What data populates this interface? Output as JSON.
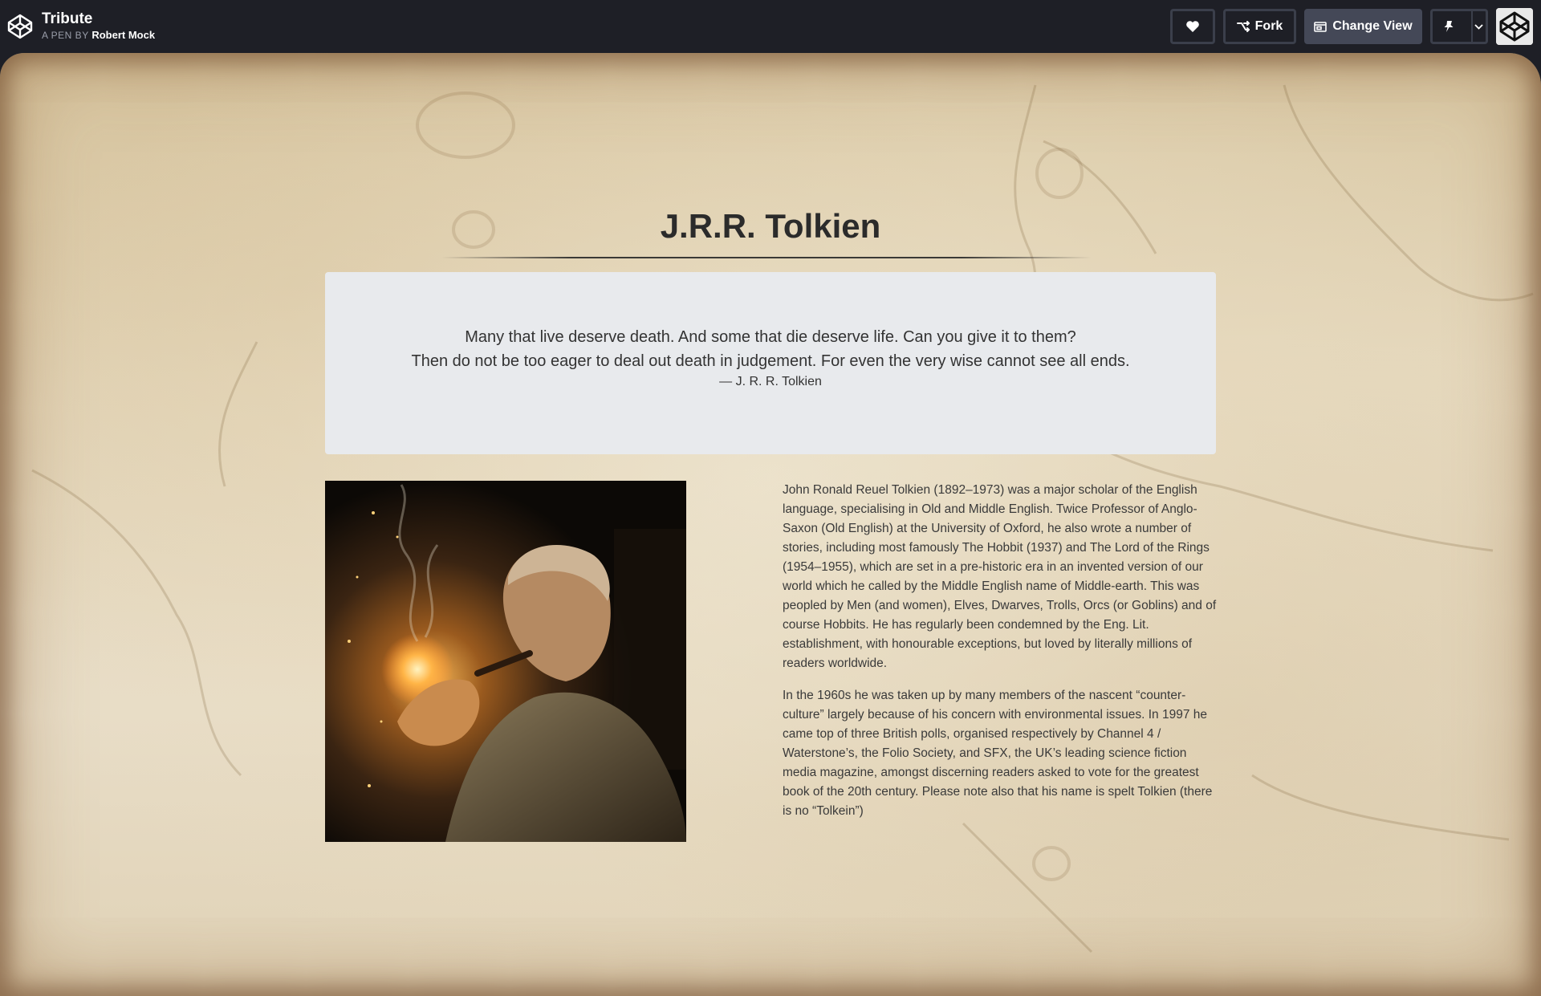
{
  "header": {
    "logo_icon": "codepen-logo-icon",
    "pen_title": "Tribute",
    "pen_by_label": "A PEN BY",
    "author": "Robert Mock",
    "buttons": {
      "heart_icon": "heart-icon",
      "fork_label": "Fork",
      "fork_icon": "fork-icon",
      "change_view_label": "Change View",
      "change_view_icon": "window-icon",
      "pin_icon": "pin-icon",
      "chevron_icon": "chevron-down-icon"
    },
    "avatar_icon": "codepen-avatar"
  },
  "main": {
    "title": "J.R.R. Tolkien",
    "quote": {
      "line1": "Many that live deserve death. And some that die deserve life. Can you give it to them?",
      "line2": "Then do not be too eager to deal out death in judgement. For even the very wise cannot see all ends.",
      "author": "— J. R. R. Tolkien"
    },
    "image": {
      "subject": "tolkien-portrait-lighting-pipe"
    },
    "bio": {
      "paragraph1": "John Ronald Reuel Tolkien (1892–1973) was a major scholar of the English language, specialising in Old and Middle English. Twice Professor of Anglo-Saxon (Old English) at the University of Oxford, he also wrote a number of stories, including most famously The Hobbit (1937) and The Lord of the Rings (1954–1955), which are set in a pre-historic era in an invented version of our world which he called by the Middle English name of Middle-earth. This was peopled by Men (and women), Elves, Dwarves, Trolls, Orcs (or Goblins) and of course Hobbits. He has regularly been condemned by the Eng. Lit. establishment, with honourable exceptions, but loved by literally millions of readers worldwide.",
      "paragraph2": "In the 1960s he was taken up by many members of the nascent “counter-culture” largely because of his concern with environmental issues. In 1997 he came top of three British polls, organised respectively by Channel 4 / Waterstone’s, the Folio Society, and SFX, the UK’s leading science fiction media magazine, amongst discerning readers asked to vote for the greatest book of the 20th century. Please note also that his name is spelt Tolkien (there is no “Tolkein”)"
    }
  },
  "colors": {
    "topbar_bg": "#1e1f26",
    "button_bg": "#444857",
    "parchment": "#e5d8bd",
    "quote_box_bg": "#e8eaed",
    "text_dark": "#2b2b2b"
  }
}
